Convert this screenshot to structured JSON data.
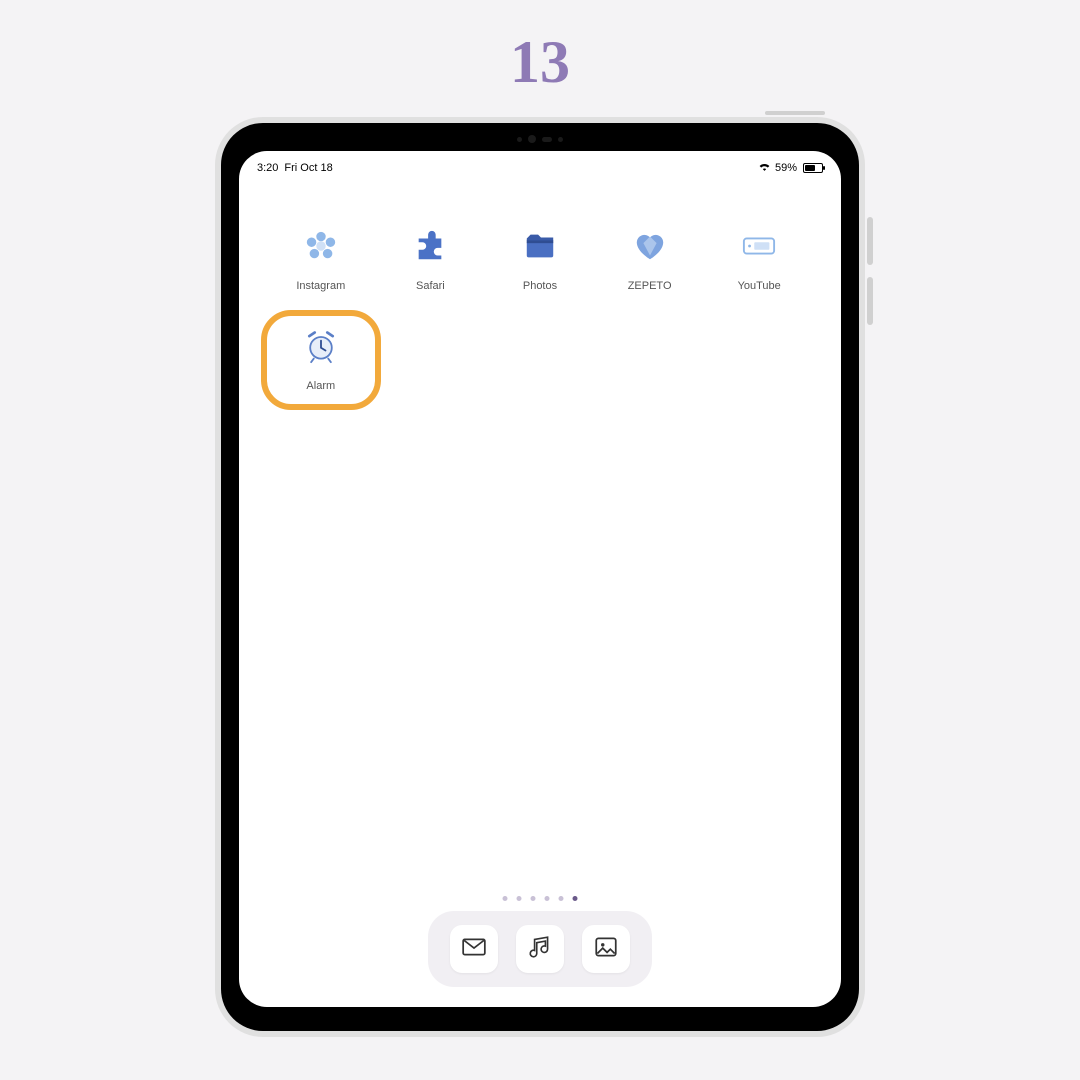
{
  "page_number": "13",
  "status": {
    "time": "3:20",
    "date": "Fri Oct 18",
    "battery_pct": "59%"
  },
  "apps": {
    "row1": [
      {
        "label": "Instagram",
        "key": "instagram"
      },
      {
        "label": "Safari",
        "key": "safari"
      },
      {
        "label": "Photos",
        "key": "photos"
      },
      {
        "label": "ZEPETO",
        "key": "zepeto"
      },
      {
        "label": "YouTube",
        "key": "youtube"
      }
    ],
    "row2": [
      {
        "label": "Alarm",
        "key": "alarm",
        "highlighted": true
      }
    ]
  },
  "pager": {
    "count": 6,
    "active_index": 5
  },
  "dock": [
    {
      "key": "mail"
    },
    {
      "key": "music"
    },
    {
      "key": "gallery"
    }
  ]
}
